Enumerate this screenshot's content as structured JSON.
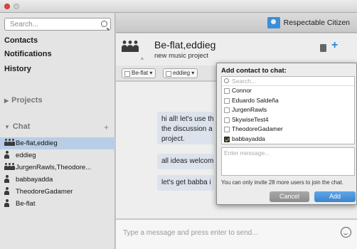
{
  "window": {
    "controls": [
      "close",
      "minimize"
    ]
  },
  "sidebar": {
    "search_placeholder": "Search...",
    "nav": [
      "Contacts",
      "Notifications",
      "History"
    ],
    "projects_label": "Projects",
    "chat_label": "Chat",
    "add_chat_symbol": "+",
    "chats": [
      {
        "label": "Be-flat,eddieg",
        "type": "group",
        "selected": true
      },
      {
        "label": "eddieg",
        "type": "person"
      },
      {
        "label": "JurgenRawls,Theodore...",
        "type": "group"
      },
      {
        "label": "babbayadda",
        "type": "person"
      },
      {
        "label": "TheodoreGadamer",
        "type": "person"
      },
      {
        "label": "Be-flat",
        "type": "person"
      }
    ]
  },
  "topbar": {
    "username": "Respectable Citizen"
  },
  "conversation": {
    "title": "Be-flat,eddieg",
    "subtitle": "new music project",
    "tags": [
      "Be-flat",
      "eddieg"
    ],
    "messages": [
      "hi all! let's use th",
      "the discussion a",
      "project.",
      "all ideas welcom",
      "let's get babba i"
    ],
    "composer_placeholder": "Type a message and press enter to send..."
  },
  "popup": {
    "title": "Add contact to chat:",
    "search_placeholder": "Search...",
    "contacts": [
      {
        "name": "Connor",
        "checked": false
      },
      {
        "name": "Eduardo Saldeña",
        "checked": false
      },
      {
        "name": "JurgenRawls",
        "checked": false
      },
      {
        "name": "SkywiseTest4",
        "checked": false
      },
      {
        "name": "TheodoreGadamer",
        "checked": false
      },
      {
        "name": "babbayadda",
        "checked": true
      }
    ],
    "message_placeholder": "Enter message...",
    "note": "You can only invite 28 more users to join the chat.",
    "cancel_label": "Cancel",
    "add_label": "Add"
  },
  "colors": {
    "accent": "#3a84cf",
    "selection": "#b9cde6",
    "close": "#e0443e"
  }
}
